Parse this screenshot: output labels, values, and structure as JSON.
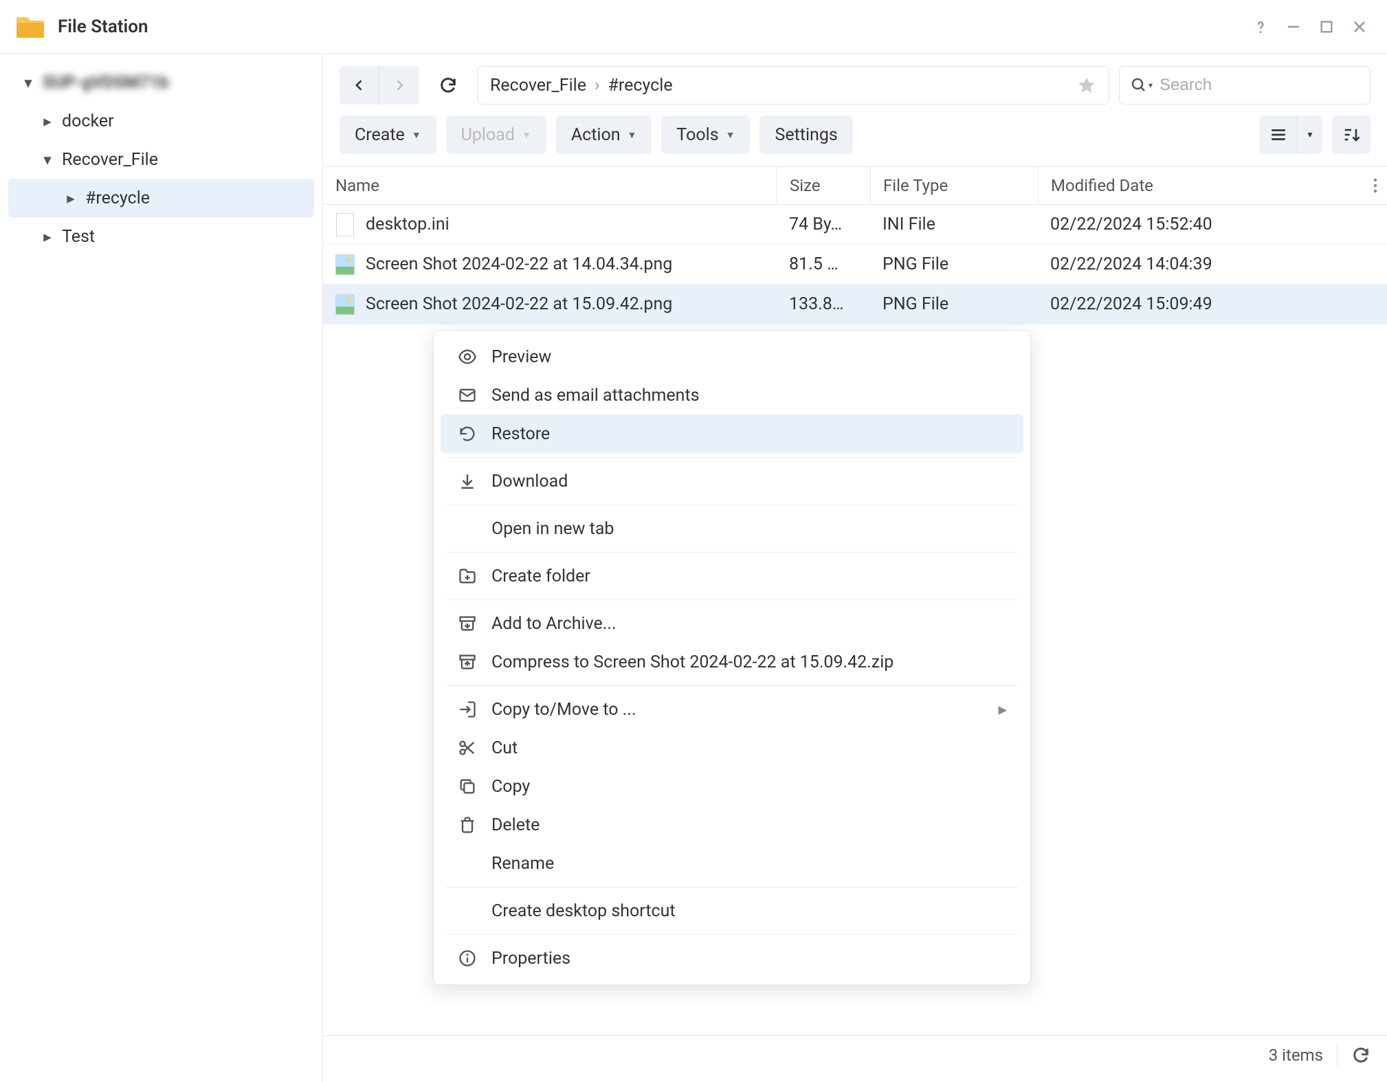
{
  "app": {
    "title": "File Station"
  },
  "tree": {
    "root": "SUP-gVDSM71b",
    "items": [
      {
        "label": "docker"
      },
      {
        "label": "Recover_File"
      },
      {
        "label": "#recycle"
      },
      {
        "label": "Test"
      }
    ]
  },
  "breadcrumb": {
    "parts": [
      "Recover_File",
      "#recycle"
    ]
  },
  "search": {
    "placeholder": "Search"
  },
  "toolbar": {
    "create": "Create",
    "upload": "Upload",
    "action": "Action",
    "tools": "Tools",
    "settings": "Settings"
  },
  "columns": {
    "name": "Name",
    "size": "Size",
    "type": "File Type",
    "date": "Modified Date"
  },
  "rows": [
    {
      "name": "desktop.ini",
      "size": "74 By…",
      "type": "INI File",
      "date": "02/22/2024 15:52:40"
    },
    {
      "name": "Screen Shot 2024-02-22 at 14.04.34.png",
      "size": "81.5 …",
      "type": "PNG File",
      "date": "02/22/2024 14:04:39"
    },
    {
      "name": "Screen Shot 2024-02-22 at 15.09.42.png",
      "size": "133.8…",
      "type": "PNG File",
      "date": "02/22/2024 15:09:49"
    }
  ],
  "ctx": {
    "preview": "Preview",
    "email": "Send as email attachments",
    "restore": "Restore",
    "download": "Download",
    "newtab": "Open in new tab",
    "createfolder": "Create folder",
    "archive": "Add to Archive...",
    "compress": "Compress to Screen Shot 2024-02-22 at 15.09.42.zip",
    "copyto": "Copy to/Move to ...",
    "cut": "Cut",
    "copy": "Copy",
    "delete": "Delete",
    "rename": "Rename",
    "shortcut": "Create desktop shortcut",
    "properties": "Properties"
  },
  "status": {
    "count": "3 items"
  }
}
